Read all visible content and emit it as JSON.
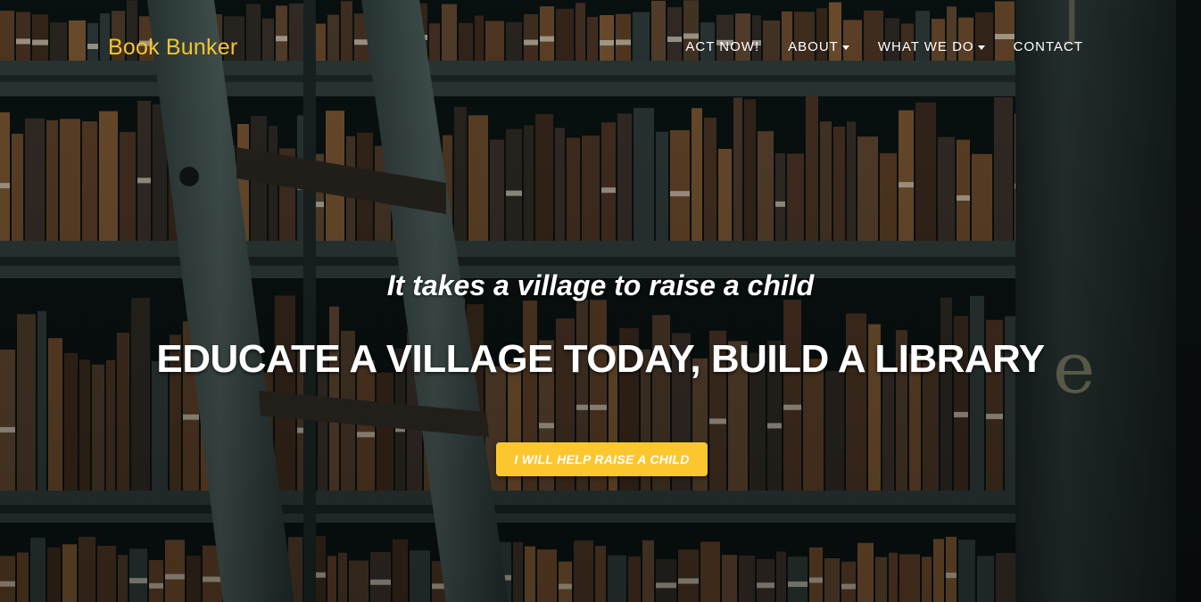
{
  "brand": {
    "name": "Book Bunker",
    "color": "#f4c430"
  },
  "nav": {
    "items": [
      {
        "label": "ACT NOW!",
        "has_dropdown": false
      },
      {
        "label": "ABOUT",
        "has_dropdown": true
      },
      {
        "label": "WHAT WE DO",
        "has_dropdown": true
      },
      {
        "label": "CONTACT",
        "has_dropdown": false
      }
    ]
  },
  "hero": {
    "tagline": "It takes a village to raise a child",
    "headline": "EDUCATE A VILLAGE TODAY, BUILD A LIBRARY",
    "cta_label": "I WILL HELP RAISE A CHILD",
    "cta_color": "#fcc72e",
    "background_icon": "library-bookshelf-photo",
    "caret_icon": "caret-down-icon"
  }
}
